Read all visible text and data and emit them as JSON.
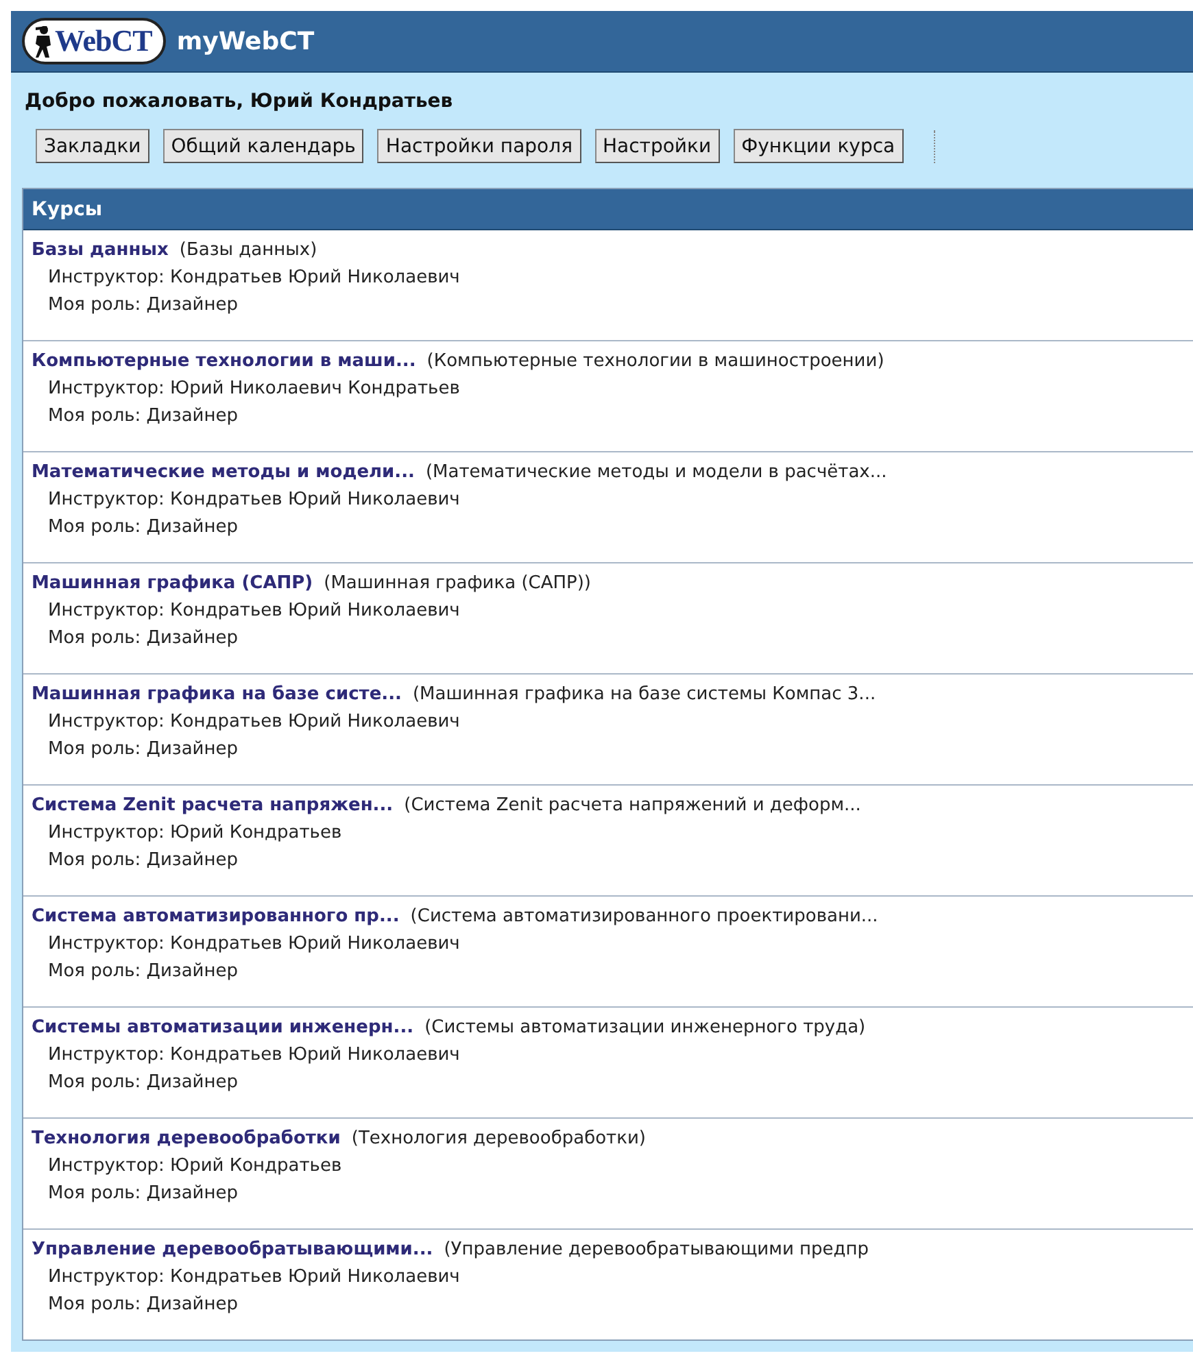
{
  "header": {
    "logo": "WebCT",
    "title": "myWebCT"
  },
  "welcome": "Добро пожаловать, Юрий Кондратьев",
  "toolbar": [
    "Закладки",
    "Общий календарь",
    "Настройки пароля",
    "Настройки",
    "Функции курса"
  ],
  "courses": {
    "heading": "Курсы",
    "items": [
      {
        "name": "Базы данных",
        "full_name": "(Базы данных)",
        "instructor": "Инструктор: Кондратьев Юрий Николаевич",
        "role": "Моя роль: Дизайнер"
      },
      {
        "name": "Компьютерные технологии в маши...",
        "full_name": "(Компьютерные технологии в машиностроении)",
        "instructor": "Инструктор: Юрий Николаевич Кондратьев",
        "role": "Моя роль: Дизайнер"
      },
      {
        "name": "Математические методы и модели...",
        "full_name": "(Математические методы и модели в расчётах...",
        "instructor": "Инструктор: Кондратьев Юрий Николаевич",
        "role": "Моя роль: Дизайнер"
      },
      {
        "name": "Машинная графика (САПР)",
        "full_name": "(Машинная графика (САПР))",
        "instructor": "Инструктор: Кондратьев Юрий Николаевич",
        "role": "Моя роль: Дизайнер"
      },
      {
        "name": "Машинная графика на базе систе...",
        "full_name": "(Машинная графика на базе системы Компас 3...",
        "instructor": "Инструктор: Кондратьев Юрий Николаевич",
        "role": "Моя роль: Дизайнер"
      },
      {
        "name": "Система Zenit расчета напряжен...",
        "full_name": "(Система Zenit расчета напряжений и деформ...",
        "instructor": "Инструктор: Юрий Кондратьев",
        "role": "Моя роль: Дизайнер"
      },
      {
        "name": "Система автоматизированного пр...",
        "full_name": "(Система автоматизированного проектировани...",
        "instructor": "Инструктор: Кондратьев Юрий Николаевич",
        "role": "Моя роль: Дизайнер"
      },
      {
        "name": "Системы автоматизации инженерн...",
        "full_name": "(Системы автоматизации инженерного труда)",
        "instructor": "Инструктор: Кондратьев Юрий Николаевич",
        "role": "Моя роль: Дизайнер"
      },
      {
        "name": "Технология деревообработки",
        "full_name": "(Технология деревообработки)",
        "instructor": "Инструктор: Юрий Кондратьев",
        "role": "Моя роль: Дизайнер"
      },
      {
        "name": "Управление деревообратывающими...",
        "full_name": "(Управление деревообратывающими предпр",
        "instructor": "Инструктор: Кондратьев Юрий Николаевич",
        "role": "Моя роль: Дизайнер"
      }
    ]
  }
}
